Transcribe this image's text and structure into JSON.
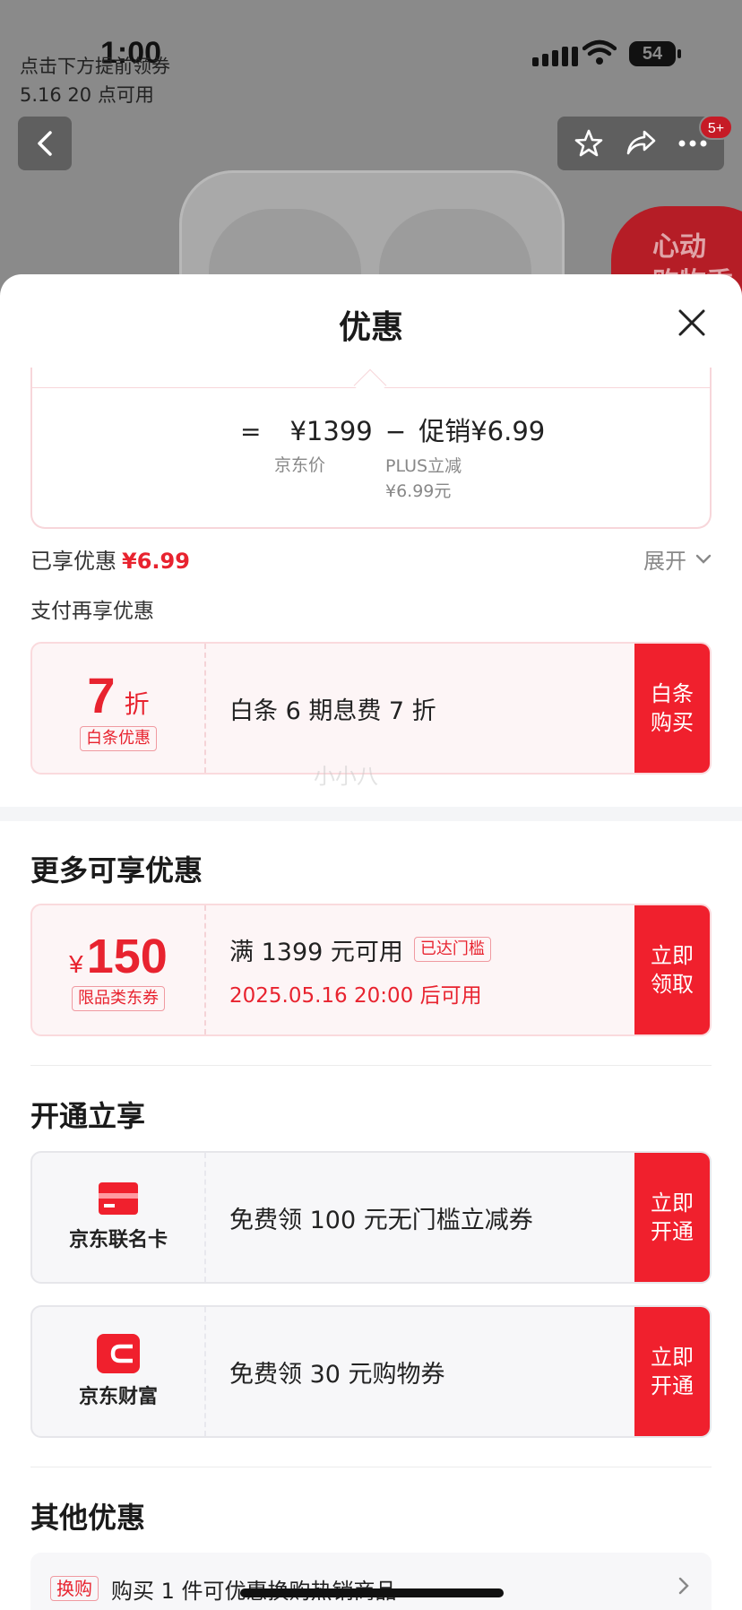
{
  "status_bar": {
    "time": "1:00",
    "battery": "54"
  },
  "background": {
    "presale_line1": "点击下方提前领券",
    "presale_line2": "5.16 20 点可用",
    "notification_count": "5+",
    "badge_text_1": "心动",
    "badge_text_2": "购物季"
  },
  "sheet": {
    "title": "优惠",
    "calc": {
      "equals": "=",
      "price": "¥1399",
      "minus": "−",
      "promo_label": "促销",
      "promo_price": "¥6.99",
      "price_caption": "京东价",
      "promo_caption_1": "PLUS立减",
      "promo_caption_2": "¥6.99元"
    },
    "enjoyed_label": "已享优惠",
    "enjoyed_value": "¥6.99",
    "expand_label": "展开",
    "pay_more_label": "支付再享优惠",
    "baitiao": {
      "discount": "7",
      "discount_unit": "折",
      "tag": "白条优惠",
      "desc": "白条 6 期息费 7 折",
      "cta_line1": "白条",
      "cta_line2": "购买"
    },
    "watermark": "小小八",
    "more_section_title": "更多可享优惠",
    "coupon150": {
      "currency": "¥",
      "amount": "150",
      "tag": "限品类东券",
      "condition": "满 1399 元可用",
      "threshold_tag": "已达门槛",
      "available_time": "2025.05.16 20:00 后可用",
      "cta_line1": "立即",
      "cta_line2": "领取"
    },
    "open_section_title": "开通立享",
    "card1": {
      "name": "京东联名卡",
      "desc": "免费领 100 元无门槛立减券",
      "cta_line1": "立即",
      "cta_line2": "开通"
    },
    "card2": {
      "name": "京东财富",
      "desc": "免费领 30 元购物券",
      "cta_line1": "立即",
      "cta_line2": "开通"
    },
    "other_section_title": "其他优惠",
    "exchange": {
      "tag": "换购",
      "desc": "购买 1 件可优惠换购热销商品"
    }
  },
  "colors": {
    "accent_red": "#f0202d",
    "sheet_bg": "#ffffff"
  }
}
